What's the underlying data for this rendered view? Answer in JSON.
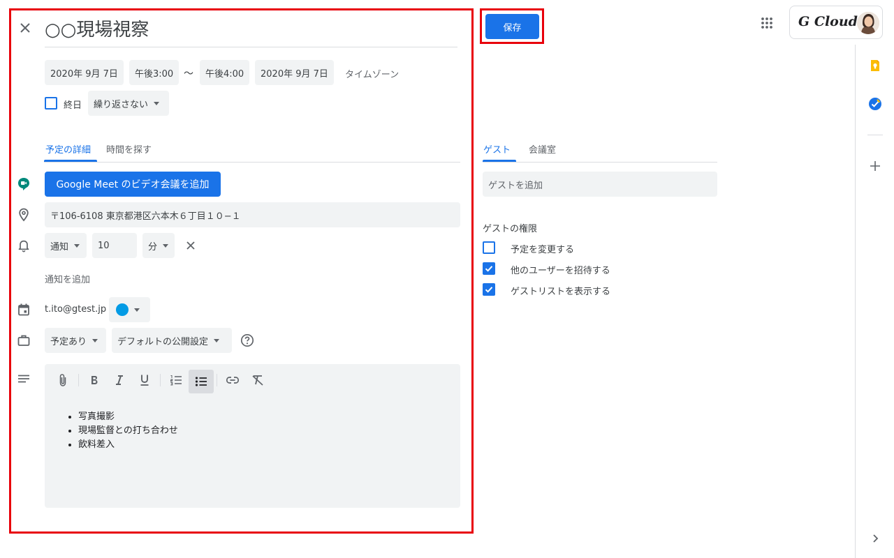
{
  "event": {
    "title": "○○現場視察",
    "start_date": "2020年 9月 7日",
    "start_time": "午後3:00",
    "separator": "〜",
    "end_time": "午後4:00",
    "end_date": "2020年 9月 7日",
    "timezone_label": "タイムゾーン",
    "allday_label": "終日",
    "repeat_value": "繰り返さない"
  },
  "tabs": {
    "details": "予定の詳細",
    "find_time": "時間を探す"
  },
  "meet_button": "Google Meet のビデオ会議を追加",
  "location": "〒106-6108 東京都港区六本木６丁目１０−１",
  "notification": {
    "type": "通知",
    "value": "10",
    "unit": "分",
    "add_label": "通知を追加"
  },
  "calendar": {
    "owner": "t.ito@gtest.jp",
    "color": "#039be5"
  },
  "availability": "予定あり",
  "visibility": "デフォルトの公開設定",
  "description": {
    "items": [
      "写真撮影",
      "現場監督との打ち合わせ",
      "飲料差入"
    ]
  },
  "save_label": "保存",
  "brand": "G Cloud",
  "guest_panel": {
    "tab_guests": "ゲスト",
    "tab_rooms": "会議室",
    "add_placeholder": "ゲストを追加",
    "permissions_title": "ゲストの権限",
    "permissions": [
      {
        "label": "予定を変更する",
        "checked": false
      },
      {
        "label": "他のユーザーを招待する",
        "checked": true
      },
      {
        "label": "ゲストリストを表示する",
        "checked": true
      }
    ]
  },
  "colors": {
    "accent": "#1a73e8",
    "highlight_frame": "#e8000b",
    "field_bg": "#f1f3f4"
  }
}
